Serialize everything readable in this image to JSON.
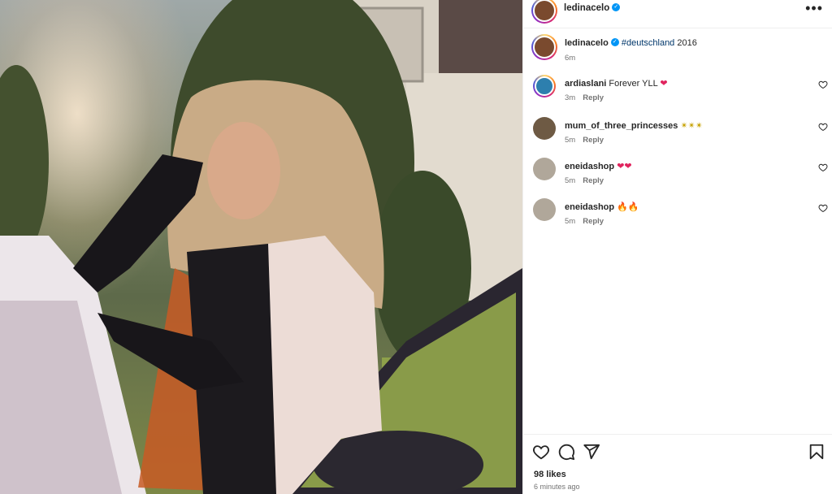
{
  "post": {
    "author": "ledinacelo",
    "more_label": "•••"
  },
  "caption": {
    "author": "ledinacelo",
    "hashtag": "#deutschland",
    "text": " 2016",
    "time": "6m"
  },
  "comments": [
    {
      "username": "ardiaslani",
      "text": "Forever YLL",
      "emoji": "❤",
      "time": "3m",
      "reply_label": "Reply",
      "ring": true,
      "avatar_color": "#2d7fae"
    },
    {
      "username": "mum_of_three_princesses",
      "text": "",
      "emoji": "✴✴✴",
      "time": "5m",
      "reply_label": "Reply",
      "ring": false,
      "avatar_color": "#6e5a44"
    },
    {
      "username": "eneidashop",
      "text": "",
      "emoji": "❤❤",
      "time": "5m",
      "reply_label": "Reply",
      "ring": false,
      "avatar_color": "#b0a79a"
    },
    {
      "username": "eneidashop",
      "text": "",
      "emoji": "🔥🔥",
      "time": "5m",
      "reply_label": "Reply",
      "ring": false,
      "avatar_color": "#b0a79a"
    }
  ],
  "footer": {
    "likes": "98 likes",
    "time": "6 minutes ago"
  },
  "icons": {
    "like": "heart-icon",
    "comment": "comment-bubble-icon",
    "share": "paper-plane-icon",
    "save": "bookmark-icon",
    "more": "more-options-icon",
    "verified": "verified-badge-icon"
  },
  "colors": {
    "link": "#00376b",
    "verified": "#0095f6",
    "muted": "#737373",
    "heart": "#e0245e"
  }
}
